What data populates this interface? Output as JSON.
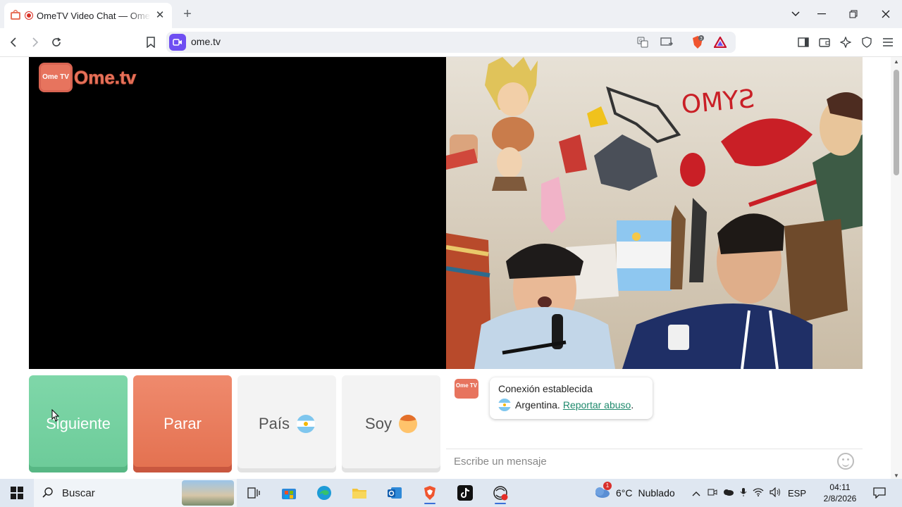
{
  "browser": {
    "tab_title": "OmeTV Video Chat — Omegle",
    "url": "ome.tv",
    "shield_badge": "3"
  },
  "site": {
    "logo_tv_text": "Ome TV",
    "logo_name": "Ome.tv"
  },
  "controls": {
    "next_label": "Siguiente",
    "stop_label": "Parar",
    "country_label": "País",
    "soy_label": "Soy"
  },
  "chat": {
    "logo_text": "Ome TV",
    "status_title": "Conexión establecida",
    "country_text": "Argentina.",
    "report_link": "Reportar abuso",
    "report_suffix": ".",
    "input_placeholder": "Escribe un mensaje"
  },
  "taskbar": {
    "search_label": "Buscar",
    "weather_temp": "6°C",
    "weather_desc": "Nublado",
    "weather_badge": "1",
    "language": "ESP",
    "time": "04:11",
    "date": "2/8/2026"
  },
  "colors": {
    "next_green": "#6ccb99",
    "stop_red": "#e3704f",
    "brand_orange": "#e7745e",
    "url_badge": "#6e4ef2"
  }
}
